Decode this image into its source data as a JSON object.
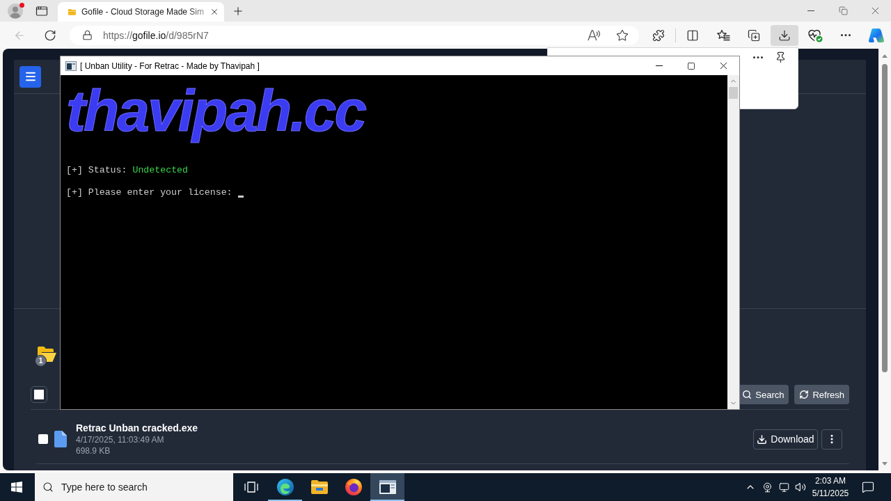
{
  "browser": {
    "profile": {
      "notification": true
    },
    "tabs": [
      {
        "title": "Gofile - Cloud Storage Made Sim",
        "selected": true
      }
    ],
    "back": {
      "disabled": true
    },
    "url": {
      "scheme": "https://",
      "host": "gofile.io",
      "path": "/d/985rN7"
    },
    "toolbar": [
      {
        "kind": "extensions",
        "pressed": false
      },
      {
        "kind": "split",
        "pressed": false
      },
      {
        "kind": "favorites",
        "pressed": false
      },
      {
        "kind": "collections",
        "pressed": false
      },
      {
        "kind": "downloads",
        "pressed": true
      },
      {
        "kind": "health",
        "pressed": false
      },
      {
        "kind": "more",
        "pressed": false
      },
      {
        "kind": "copilot",
        "pressed": false
      }
    ]
  },
  "page": {
    "folder": {
      "badge": "1"
    },
    "select_all": {
      "checked": false
    },
    "buttons": [
      {
        "kind": "search",
        "label": "Search"
      },
      {
        "kind": "refresh",
        "label": "Refresh"
      }
    ],
    "files": [
      {
        "name": "Retrac Unban cracked.exe",
        "date": "4/17/2025, 11:03:49 AM",
        "size": "698.9 KB",
        "checked": false,
        "action": "Download"
      }
    ]
  },
  "console": {
    "title": "[ Unban Utility - For Retrac - Made by Thavipah ]",
    "banner": "thavipah.cc",
    "lines": [
      {
        "kind": "status",
        "text": "[+] Status:",
        "value": "Undetected"
      },
      {
        "kind": "prompt",
        "text": "[+] Please enter your license:"
      }
    ]
  },
  "taskbar": {
    "search": {
      "placeholder": "Type here to search"
    },
    "apps": [
      {
        "kind": "taskview",
        "selected": false,
        "running": false
      },
      {
        "kind": "edge",
        "selected": false,
        "running": true
      },
      {
        "kind": "explorer",
        "selected": false,
        "running": false
      },
      {
        "kind": "firefox",
        "selected": false,
        "running": false
      },
      {
        "kind": "console",
        "selected": true,
        "running": true
      }
    ],
    "time": "2:03 AM",
    "date": "5/11/2025"
  }
}
